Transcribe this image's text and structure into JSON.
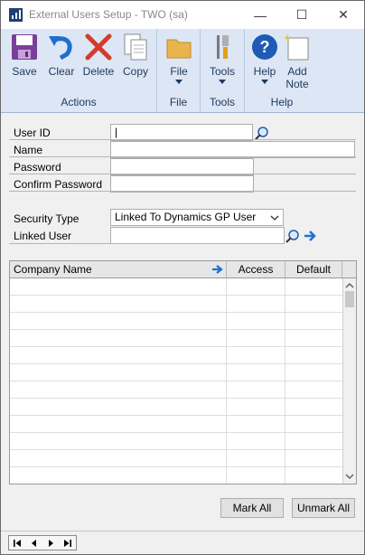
{
  "window": {
    "title": "External Users Setup  -  TWO (sa)",
    "minimize_glyph": "—",
    "maximize_glyph": "☐",
    "close_glyph": "✕"
  },
  "ribbon": {
    "groups": {
      "actions": "Actions",
      "file": "File",
      "tools": "Tools",
      "help": "Help"
    },
    "buttons": {
      "save": "Save",
      "clear": "Clear",
      "delete": "Delete",
      "copy": "Copy",
      "file": "File",
      "tools": "Tools",
      "help": "Help",
      "add_note_1": "Add",
      "add_note_2": "Note"
    }
  },
  "form": {
    "user_id_label": "User ID",
    "user_id_value": "|",
    "name_label": "Name",
    "name_value": "",
    "password_label": "Password",
    "password_value": "",
    "confirm_password_label": "Confirm Password",
    "confirm_password_value": "",
    "security_type_label": "Security Type",
    "security_type_value": "Linked To Dynamics GP User",
    "linked_user_label": "Linked User",
    "linked_user_value": ""
  },
  "grid": {
    "columns": [
      "Company Name",
      "Access",
      "Default"
    ],
    "rows": []
  },
  "buttons": {
    "mark_all": "Mark All",
    "unmark_all": "Unmark All"
  },
  "colors": {
    "ribbon_bg": "#dce6f4",
    "accent_blue": "#1f6fd0",
    "delete_red": "#d43b2b",
    "folder_yellow": "#e9b44c"
  }
}
